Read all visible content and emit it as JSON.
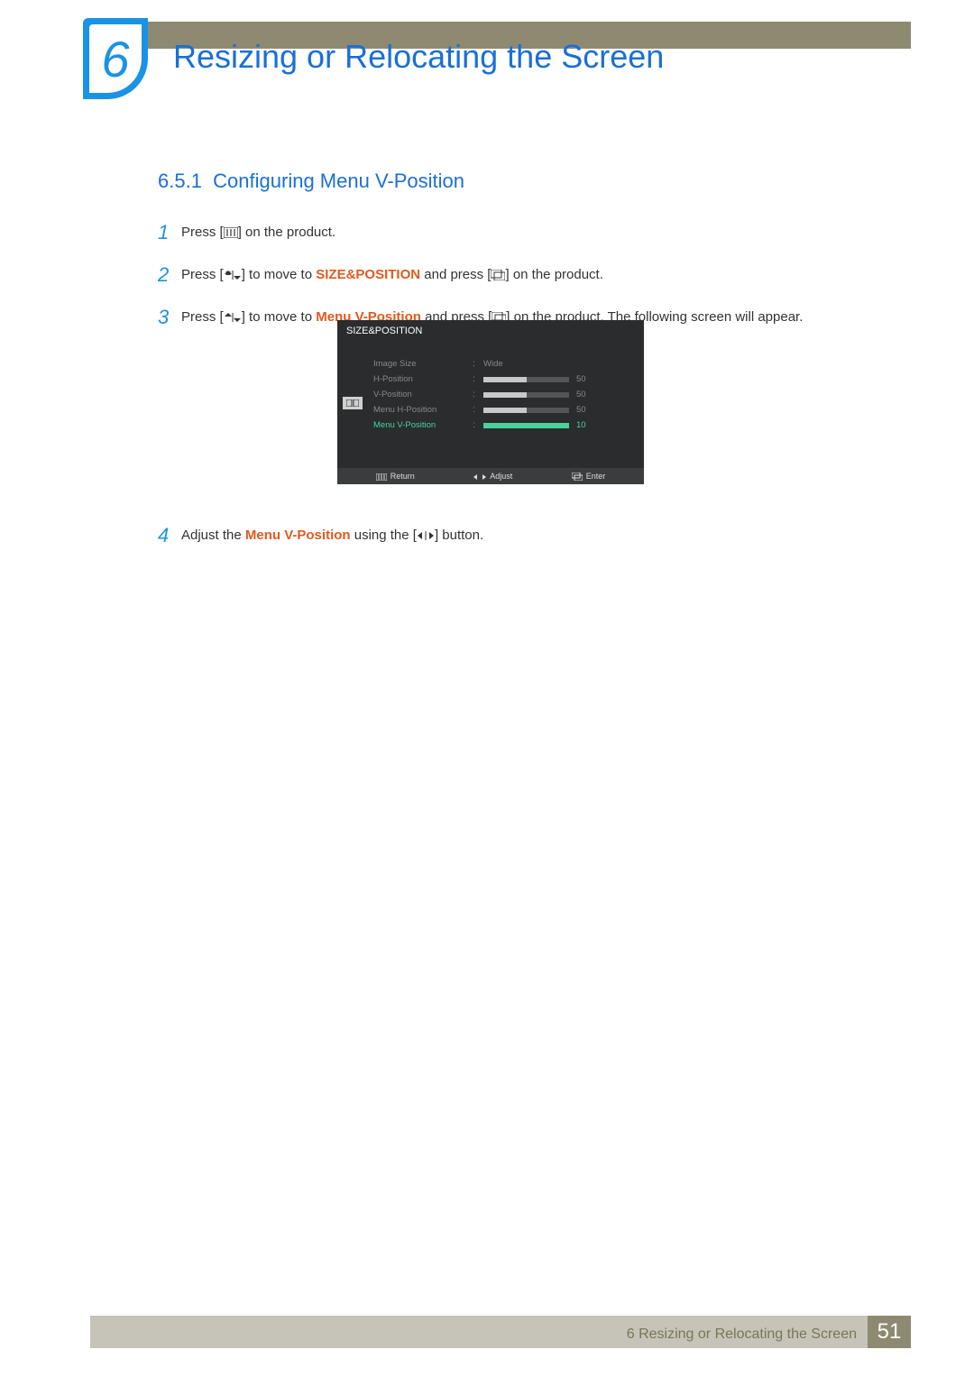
{
  "chapter_number": "6",
  "page_title": "Resizing or Relocating the Screen",
  "section_number": "6.5.1",
  "section_title": "Configuring Menu V-Position",
  "steps": {
    "s1": {
      "num": "1",
      "t1": "Press [",
      "t2": "] on the product."
    },
    "s2": {
      "num": "2",
      "t1": "Press [",
      "t2": "] to move to ",
      "em": "SIZE&POSITION",
      "t3": " and press [",
      "t4": "] on the product."
    },
    "s3": {
      "num": "3",
      "t1": "Press [",
      "t2": "] to move to ",
      "em": "Menu V-Position",
      "t3": " and press [",
      "t4": "] on the product. The following screen will appear."
    },
    "s4": {
      "num": "4",
      "t1": "Adjust the ",
      "em": "Menu V-Position",
      "t2": " using the [",
      "t3": "] button."
    }
  },
  "osd": {
    "title": "SIZE&POSITION",
    "rows": [
      {
        "label": "Image Size",
        "value": "Wide"
      },
      {
        "label": "H-Position",
        "slider": 50,
        "num": "50"
      },
      {
        "label": "V-Position",
        "slider": 50,
        "num": "50"
      },
      {
        "label": "Menu H-Position",
        "slider": 50,
        "num": "50"
      },
      {
        "label": "Menu V-Position",
        "slider": 100,
        "num": "10",
        "active": true
      }
    ],
    "footer": {
      "return": "Return",
      "adjust": "Adjust",
      "enter": "Enter"
    }
  },
  "footer": {
    "chapter": "6",
    "title": "Resizing or Relocating the Screen",
    "page": "51"
  }
}
